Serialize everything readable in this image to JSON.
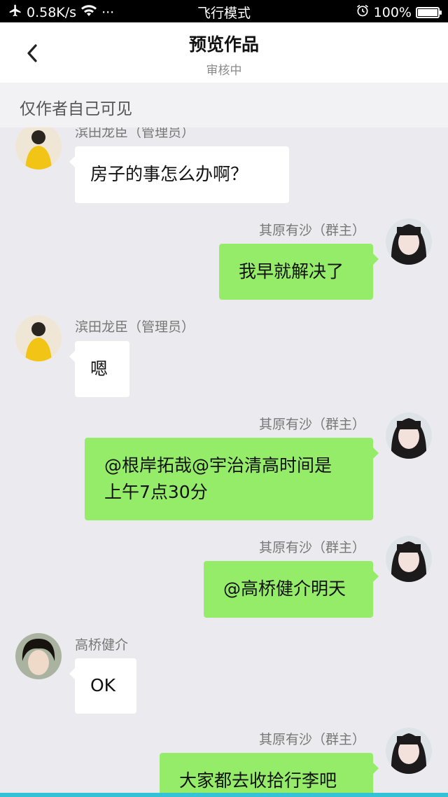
{
  "status_bar": {
    "speed": "0.58K/s",
    "mode": "飞行模式",
    "battery_text": "100%",
    "battery_level": 1.0,
    "dots": "···"
  },
  "header": {
    "title": "预览作品",
    "subtitle": "审核中"
  },
  "notice": "仅作者自己可见",
  "colors": {
    "bubble_green": "#95ec69",
    "background": "#ebebef",
    "accent_bottom": "#34c2d6"
  },
  "messages": [
    {
      "side": "left",
      "sender": "滨田龙臣（管理员）",
      "text": "房子的事怎么办啊？"
    },
    {
      "side": "right",
      "sender": "其原有沙（群主）",
      "text": "我早就解决了"
    },
    {
      "side": "left",
      "sender": "滨田龙臣（管理员）",
      "text": "嗯"
    },
    {
      "side": "right",
      "sender": "其原有沙（群主）",
      "text_line1": "@根岸拓哉@宇治清高时间是",
      "text_line2": "上午7点30分"
    },
    {
      "side": "right",
      "sender": "其原有沙（群主）",
      "text": "@高桥健介明天"
    },
    {
      "side": "left",
      "sender": "高桥健介",
      "text": "OK"
    },
    {
      "side": "right",
      "sender": "其原有沙（群主）",
      "text": "大家都去收拾行李吧"
    }
  ]
}
